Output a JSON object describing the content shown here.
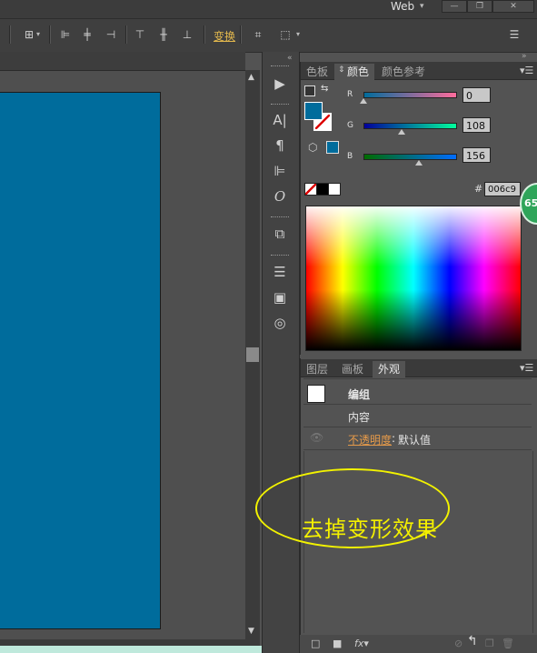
{
  "window": {
    "workspace_label": "Web",
    "minimize": "—",
    "restore": "❐",
    "close": "✕"
  },
  "control_bar": {
    "transform_label": "变换",
    "icons": [
      "grid-icon",
      "align-left-icon",
      "align-hcenter-icon",
      "align-right-icon",
      "align-top-icon",
      "align-vcenter-icon",
      "align-bottom-icon",
      "transform-icon",
      "crop-icon",
      "panel-menu-icon"
    ]
  },
  "color_panel": {
    "tabs": [
      "色板",
      "颜色",
      "颜色参考"
    ],
    "active_tab": "颜色",
    "channels": [
      {
        "label": "R",
        "value": "0",
        "slider_fraction": 0.0
      },
      {
        "label": "G",
        "value": "108",
        "slider_fraction": 0.42
      },
      {
        "label": "B",
        "value": "156",
        "slider_fraction": 0.61
      }
    ],
    "hex_symbol": "#",
    "hex_value": "006c9",
    "fill_color": "#006c9c",
    "badge_text": "65"
  },
  "appearance_panel": {
    "tabs": [
      "图层",
      "画板",
      "外观"
    ],
    "active_tab": "外观",
    "group_label": "编组",
    "content_label": "内容",
    "opacity_link": "不透明度",
    "opacity_sep": ":",
    "opacity_value": "默认值"
  },
  "annotation": {
    "text": "去掉变形效果",
    "color": "#f4f000"
  },
  "artboard_color": "#006c9c"
}
